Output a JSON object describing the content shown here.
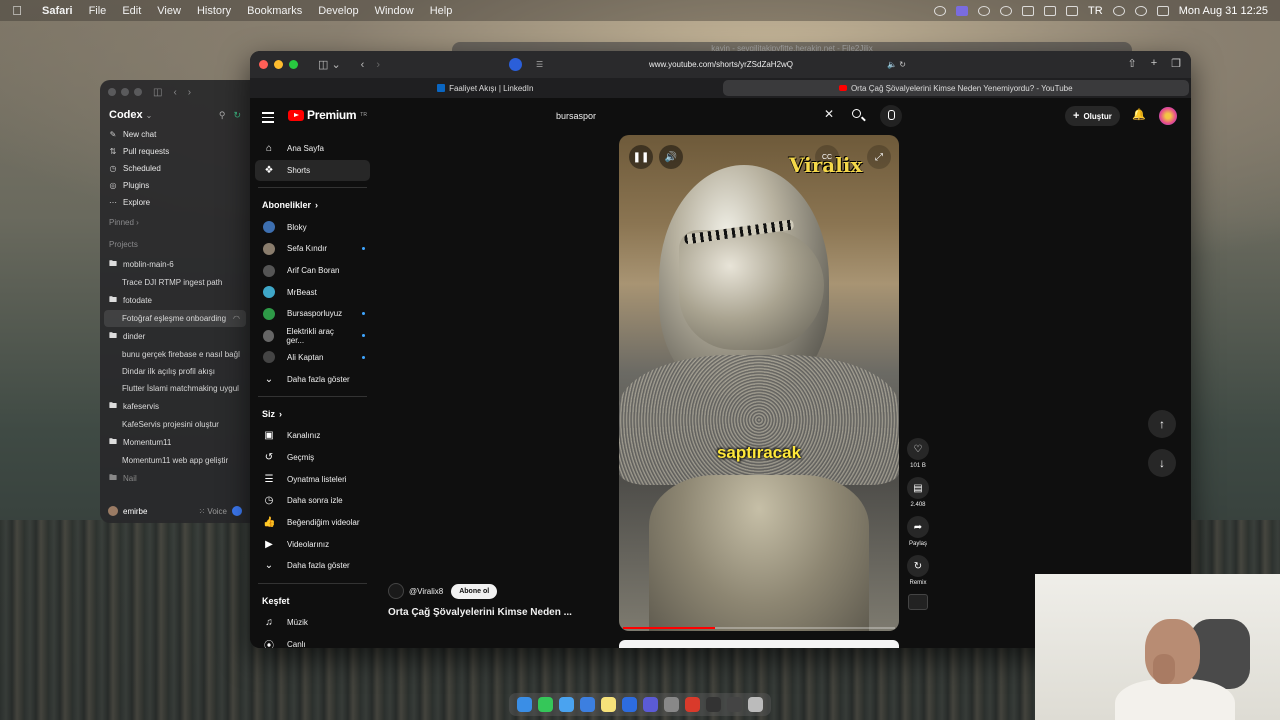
{
  "menubar": {
    "app_name": "Safari",
    "items": [
      "File",
      "Edit",
      "View",
      "History",
      "Bookmarks",
      "Develop",
      "Window",
      "Help"
    ],
    "lang": "TR",
    "clock": "Mon Aug 31  12:25"
  },
  "codex": {
    "app_name": "Codex",
    "nav": [
      {
        "label": "New chat",
        "icon": "edit-icon"
      },
      {
        "label": "Pull requests",
        "icon": "pull-request-icon"
      },
      {
        "label": "Scheduled",
        "icon": "clock-icon"
      },
      {
        "label": "Plugins",
        "icon": "plugin-icon"
      },
      {
        "label": "Explore",
        "icon": "more-icon"
      }
    ],
    "pinned_label": "Pinned",
    "projects_label": "Projects",
    "projects": [
      {
        "name": "moblin-main-6",
        "threads": [
          "Trace DJI RTMP ingest path"
        ]
      },
      {
        "name": "fotodate",
        "threads": [
          "Fotoğraf eşleşme onboarding"
        ]
      },
      {
        "name": "dinder",
        "threads": [
          "bunu gerçek firebase e nasıl bağl",
          "Dindar ilk açılış profil akışı",
          "Flutter İslami matchmaking uygul"
        ]
      },
      {
        "name": "kafeservis",
        "threads": [
          "KafeServis projesini oluştur"
        ]
      },
      {
        "name": "Momentum11",
        "threads": [
          "Momentum11 web app geliştir"
        ]
      },
      {
        "name": "Nail",
        "threads": []
      }
    ],
    "user": "emirbe",
    "voice_label": "Voice"
  },
  "bg_window_title": "kayin - sevgilitakipyfitte.herakin.net - File2Jilix",
  "safari": {
    "url": "www.youtube.com/shorts/yrZSdZaH2wQ",
    "tabs": [
      {
        "title": "Faaliyet Akışı | LinkedIn",
        "active": false
      },
      {
        "title": "Orta Çağ Şövalyelerini Kimse Neden Yenemiyordu? - YouTube",
        "active": true
      }
    ]
  },
  "youtube": {
    "logo_text": "Premium",
    "logo_sup": "TR",
    "search_value": "bursaspor",
    "create_label": "Oluştur",
    "guide_main": [
      {
        "label": "Ana Sayfa",
        "icon": "home-icon"
      },
      {
        "label": "Shorts",
        "icon": "shorts-icon"
      }
    ],
    "subscriptions_heading": "Abonelikler",
    "subscriptions": [
      {
        "name": "Bloky",
        "color": "#3d6fb0",
        "live": false
      },
      {
        "name": "Sefa Kındır",
        "color": "#8a7d6d",
        "live": true
      },
      {
        "name": "Arif Can Boran",
        "color": "#555555",
        "live": false
      },
      {
        "name": "MrBeast",
        "color": "#3fa7c8",
        "live": false
      },
      {
        "name": "Bursasporluyuz",
        "color": "#2e9a47",
        "live": true
      },
      {
        "name": "Elektrikli araç ger...",
        "color": "#666666",
        "live": true
      },
      {
        "name": "Ali Kaptan",
        "color": "#444444",
        "live": true
      }
    ],
    "show_more": "Daha fazla göster",
    "you_heading": "Siz",
    "you_items": [
      {
        "label": "Kanalınız",
        "icon": "channel-icon"
      },
      {
        "label": "Geçmiş",
        "icon": "history-icon"
      },
      {
        "label": "Oynatma listeleri",
        "icon": "playlist-icon"
      },
      {
        "label": "Daha sonra izle",
        "icon": "watch-later-icon"
      },
      {
        "label": "Beğendiğim videolar",
        "icon": "like-icon"
      },
      {
        "label": "Videolarınız",
        "icon": "your-videos-icon"
      }
    ],
    "show_more_2": "Daha fazla göster",
    "explore_heading": "Keşfet",
    "explore_items": [
      {
        "label": "Müzik",
        "icon": "music-icon"
      },
      {
        "label": "Canlı",
        "icon": "live-icon"
      }
    ],
    "video": {
      "brand_overlay": "Viralix",
      "caption": "saptıracak",
      "channel": "@Viralix8",
      "subscribe_label": "Abone ol",
      "title": "Orta Çağ Şövalyelerini Kimse Neden ...",
      "progress": 0.34,
      "likes": "101 B",
      "comments": "2.408",
      "share_label": "Paylaş",
      "remix_label": "Remix"
    }
  }
}
